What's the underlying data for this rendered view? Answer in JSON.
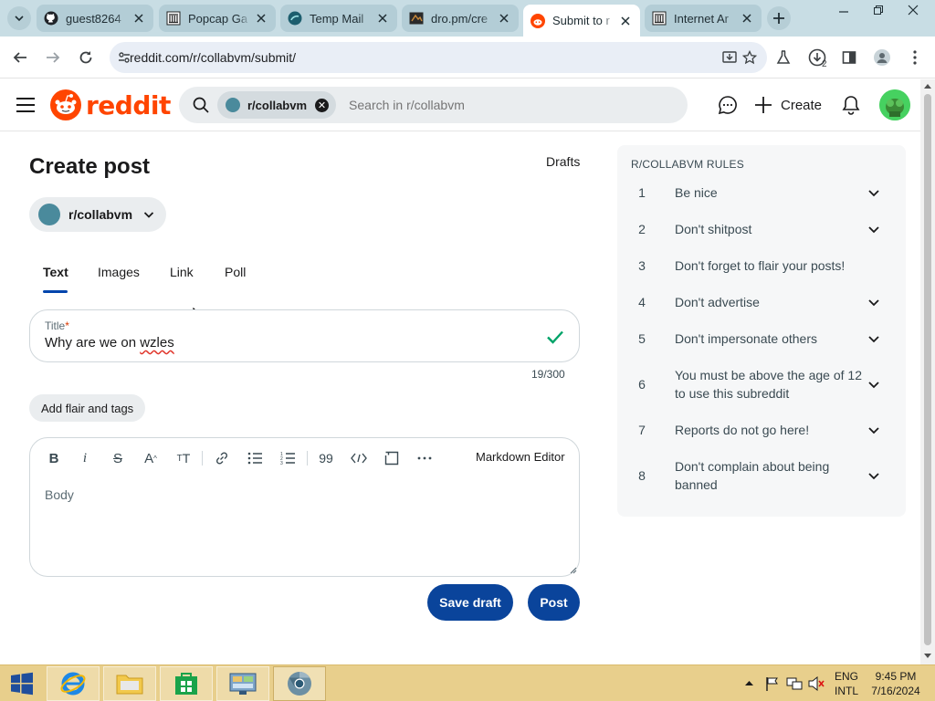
{
  "browser": {
    "tabs": [
      {
        "title": "guest8264",
        "favicon": "github-icon",
        "active": false
      },
      {
        "title": "Popcap Ga",
        "favicon": "archive-icon",
        "active": false
      },
      {
        "title": "Temp Mail",
        "favicon": "tempmail-icon",
        "active": false
      },
      {
        "title": "dro.pm/cre",
        "favicon": "drop-icon",
        "active": false
      },
      {
        "title": "Submit to r",
        "favicon": "reddit-icon",
        "active": true
      },
      {
        "title": "Internet Ar",
        "favicon": "archive-icon",
        "active": false
      }
    ],
    "url": "reddit.com/r/collabvm/submit/",
    "download_count": "2"
  },
  "header": {
    "logo_text": "reddit",
    "search_chip": "r/collabvm",
    "search_placeholder": "Search in r/collabvm",
    "create_label": "Create"
  },
  "main": {
    "page_title": "Create post",
    "drafts_label": "Drafts",
    "community": "r/collabvm",
    "post_tabs": [
      "Text",
      "Images",
      "Link",
      "Poll"
    ],
    "active_tab": "Text",
    "title_field": {
      "label": "Title",
      "required_mark": "*",
      "value_prefix": "Why are we on ",
      "value_misspelled": "wzles",
      "char_count": "19/300"
    },
    "flair_label": "Add flair and tags",
    "editor": {
      "toolbar": [
        "bold",
        "italic",
        "strikethrough",
        "superscript",
        "heading",
        "link",
        "bullet-list",
        "numbered-list",
        "quote",
        "code",
        "code-block",
        "more"
      ],
      "markdown_toggle": "Markdown Editor",
      "body_placeholder": "Body"
    },
    "save_draft_label": "Save draft",
    "post_label": "Post"
  },
  "sidebar": {
    "rules_title": "R/COLLABVM RULES",
    "rules": [
      {
        "num": "1",
        "text": "Be nice",
        "expandable": true
      },
      {
        "num": "2",
        "text": "Don't shitpost",
        "expandable": true
      },
      {
        "num": "3",
        "text": "Don't forget to flair your posts!",
        "expandable": false
      },
      {
        "num": "4",
        "text": "Don't advertise",
        "expandable": true
      },
      {
        "num": "5",
        "text": "Don't impersonate others",
        "expandable": true
      },
      {
        "num": "6",
        "text": "You must be above the age of 12 to use this subreddit",
        "expandable": true
      },
      {
        "num": "7",
        "text": "Reports do not go here!",
        "expandable": true
      },
      {
        "num": "8",
        "text": "Don't complain about being banned",
        "expandable": true
      }
    ]
  },
  "taskbar": {
    "language": "ENG",
    "layout": "INTL",
    "time": "9:45 PM",
    "date": "7/16/2024"
  },
  "colors": {
    "reddit_orange": "#ff4500",
    "primary_button": "#0a449b",
    "tab_underline": "#0045ac",
    "taskbar": "#e8cf8c"
  }
}
